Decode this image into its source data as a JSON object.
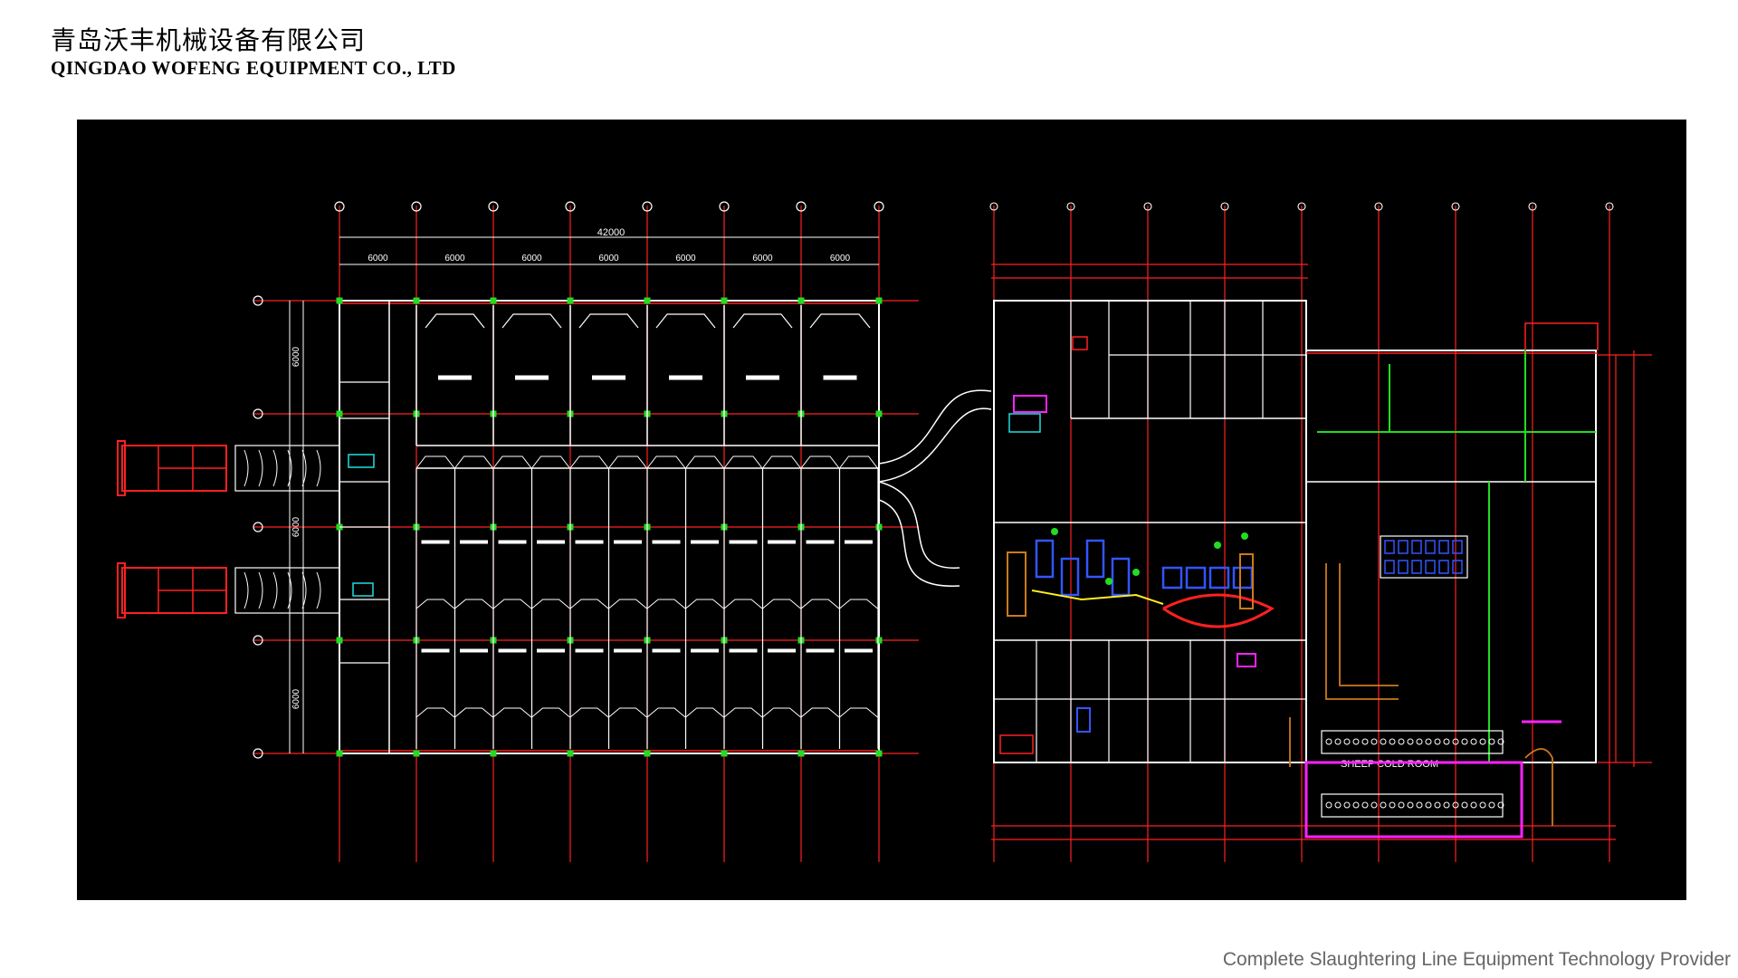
{
  "header": {
    "company_cn": "青岛沃丰机械设备有限公司",
    "company_en": "QINGDAO WOFENG EQUIPMENT CO., LTD"
  },
  "footer": {
    "tagline": "Complete Slaughtering Line Equipment Technology Provider"
  },
  "drawing": {
    "background": "#000000",
    "colors": {
      "red": "#ff2020",
      "white": "#ffffff",
      "green": "#22dd22",
      "magenta": "#ff22ff",
      "cyan": "#22dddd",
      "blue": "#3355ff",
      "orange": "#cc7a1a",
      "yellow": "#ffee22"
    },
    "top_dimension": "42000",
    "bay_dimensions": [
      "6000",
      "6000",
      "6000",
      "6000",
      "6000",
      "6000",
      "6000"
    ],
    "side_dimensions": [
      "6000",
      "6000",
      "6000"
    ],
    "cold_room_label": "SHEEP COLD ROOM"
  }
}
